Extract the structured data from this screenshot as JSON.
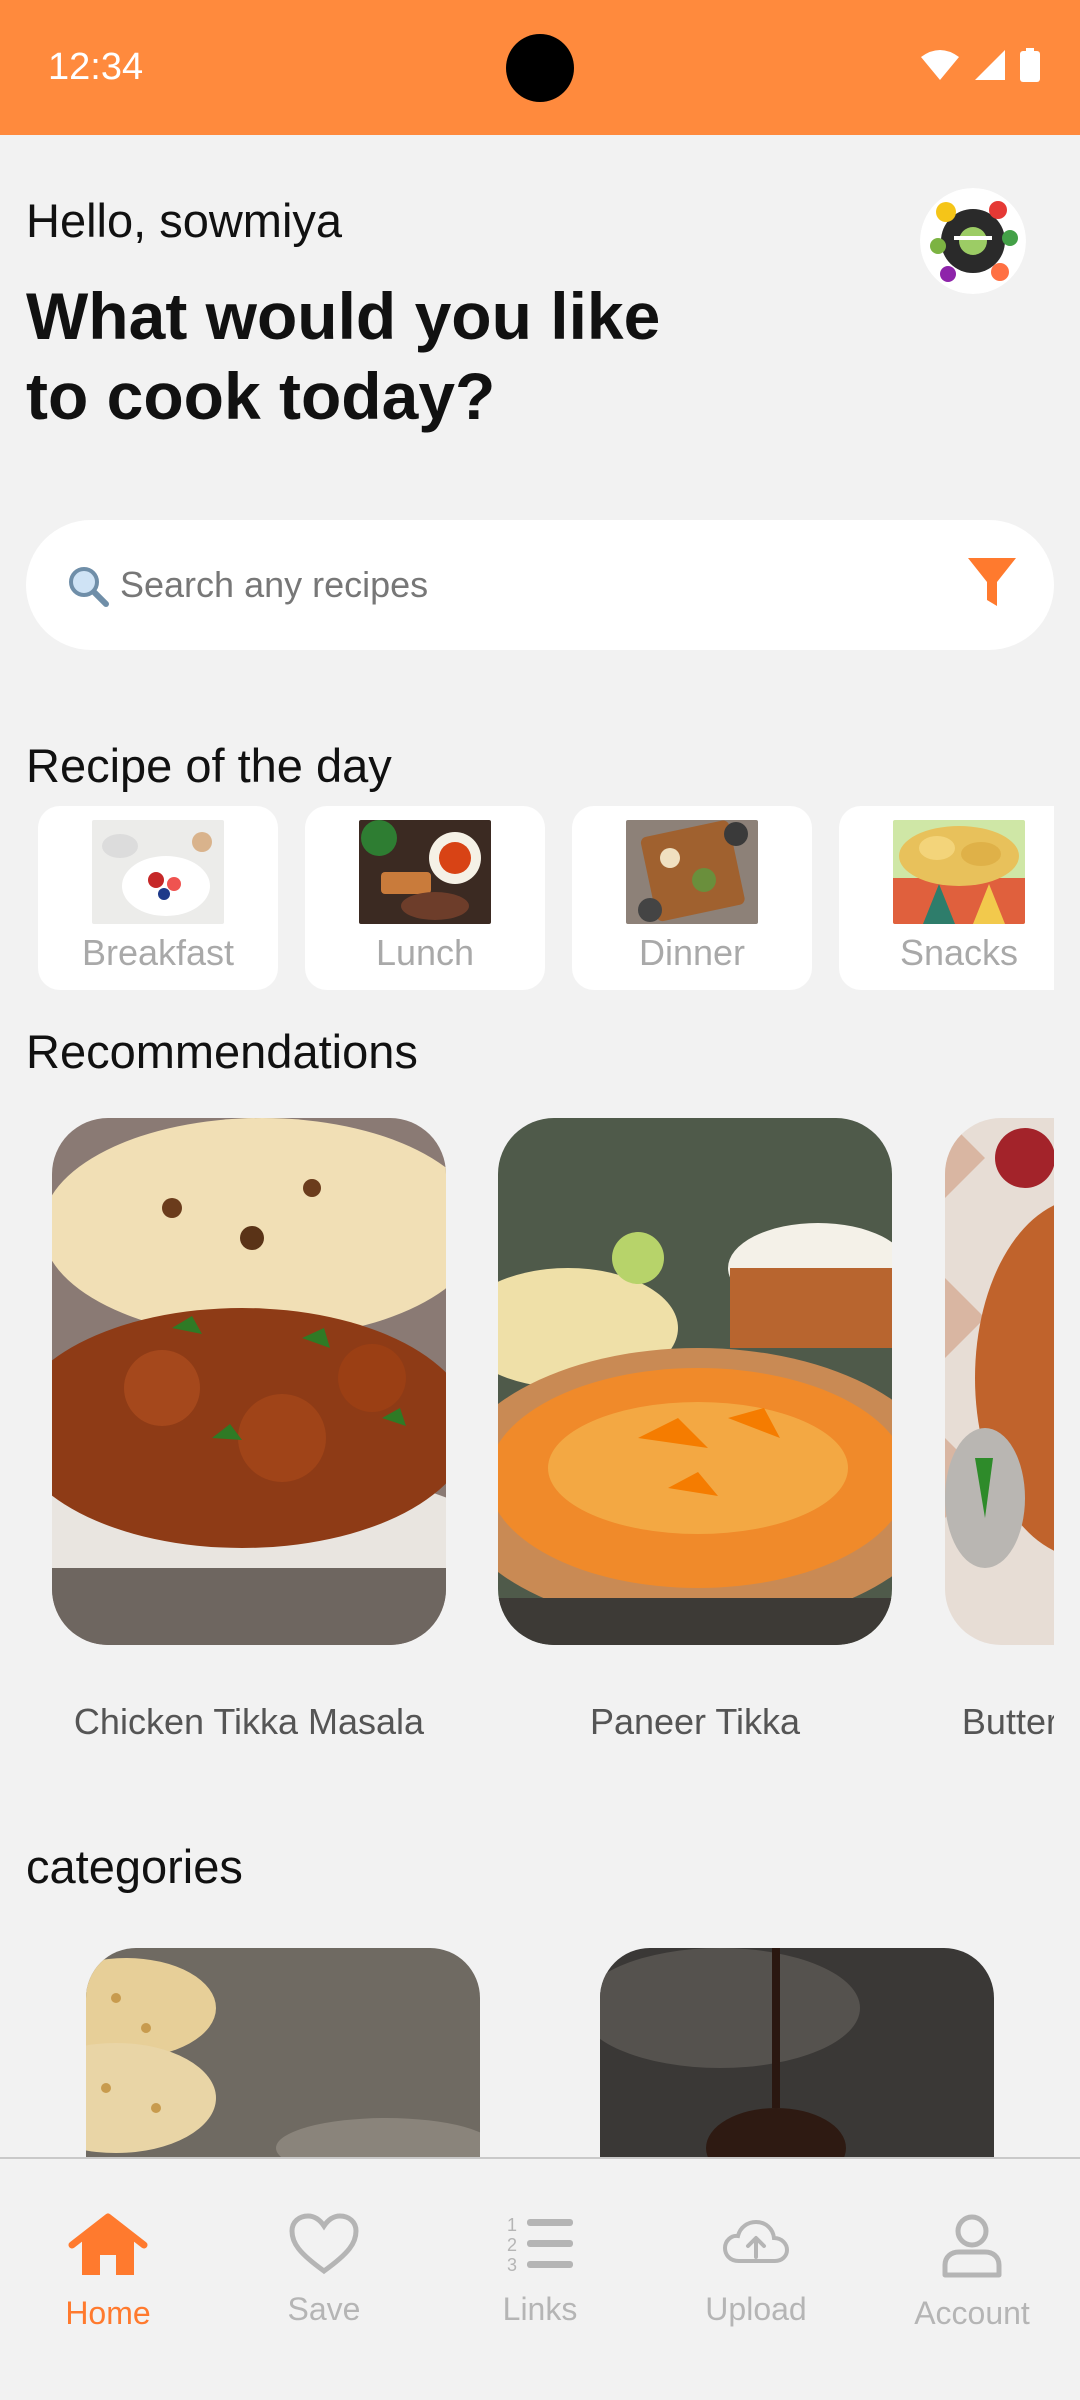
{
  "status_bar": {
    "time": "12:34"
  },
  "header": {
    "greeting": "Hello, sowmiya",
    "headline": "What would you like to cook today?"
  },
  "search": {
    "placeholder": "Search any recipes"
  },
  "recipe_of_day": {
    "title": "Recipe of the day",
    "items": [
      {
        "label": "Breakfast"
      },
      {
        "label": "Lunch"
      },
      {
        "label": "Dinner"
      },
      {
        "label": "Snacks"
      }
    ]
  },
  "recommendations": {
    "title": "Recommendations",
    "items": [
      {
        "title": "Chicken Tikka Masala"
      },
      {
        "title": "Paneer Tikka"
      },
      {
        "title": "Butter Chicken (Murgh Makhani)"
      }
    ]
  },
  "categories": {
    "title": "categories"
  },
  "bottom_nav": {
    "items": [
      {
        "label": "Home",
        "icon": "home-icon",
        "active": true
      },
      {
        "label": "Save",
        "icon": "heart-icon"
      },
      {
        "label": "Links",
        "icon": "list-icon"
      },
      {
        "label": "Upload",
        "icon": "cloud-upload-icon"
      },
      {
        "label": "Account",
        "icon": "user-icon"
      }
    ]
  },
  "colors": {
    "accent": "#FF8A3D",
    "active_nav": "#FF7A2E",
    "inactive_nav": "#B5B5B5",
    "background": "#F2F2F2"
  }
}
